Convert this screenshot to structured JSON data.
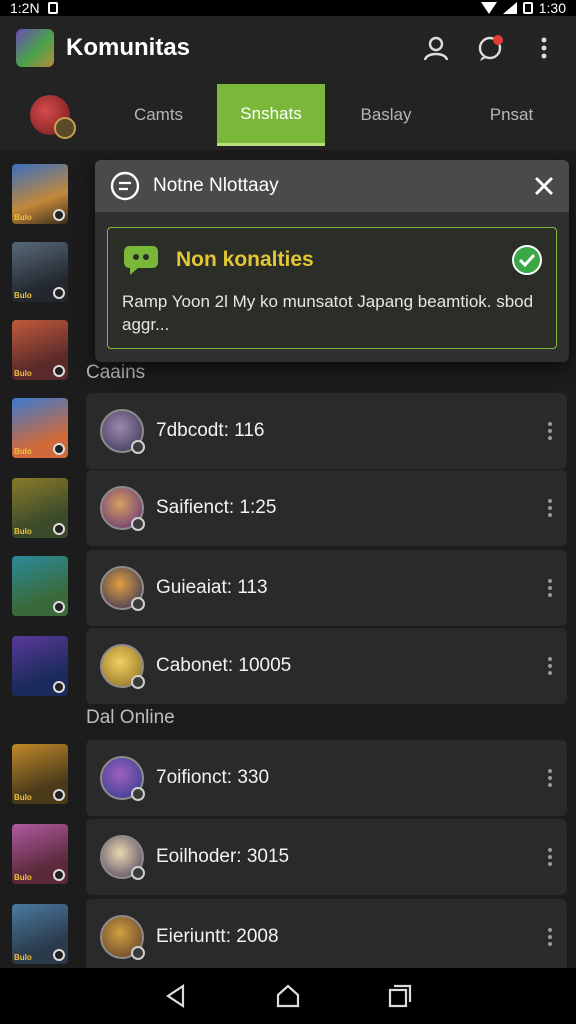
{
  "status_bar": {
    "time_left": "1:2N",
    "time_right": "1:30"
  },
  "app": {
    "title": "Komunitas"
  },
  "tabs": [
    {
      "label": "Camts"
    },
    {
      "label": "Snshats"
    },
    {
      "label": "Baslay"
    },
    {
      "label": "Pnsat"
    }
  ],
  "popup": {
    "header_title": "Notne Nlottaay",
    "title": "Non konalties",
    "message": "Ramp Yoon 2l My ko munsatot Japang beamtiok. sbod aggr..."
  },
  "sections": [
    {
      "label": "Caains"
    },
    {
      "label": "Dal Online"
    }
  ],
  "friends": [
    {
      "label": "7dbcodt: 116"
    },
    {
      "label": "Saifienct: 1:25"
    },
    {
      "label": "Guieaiat: 113"
    },
    {
      "label": "Cabonet: 10005"
    },
    {
      "label": "7oifionct: 330"
    },
    {
      "label": "Eoilhoder: 3015"
    },
    {
      "label": "Eieriuntt: 2008"
    }
  ],
  "game_thumb_text": "Bulo",
  "colors": {
    "accent": "#7ab83a",
    "popup_title": "#e3c635",
    "background": "#1c1c1c"
  }
}
